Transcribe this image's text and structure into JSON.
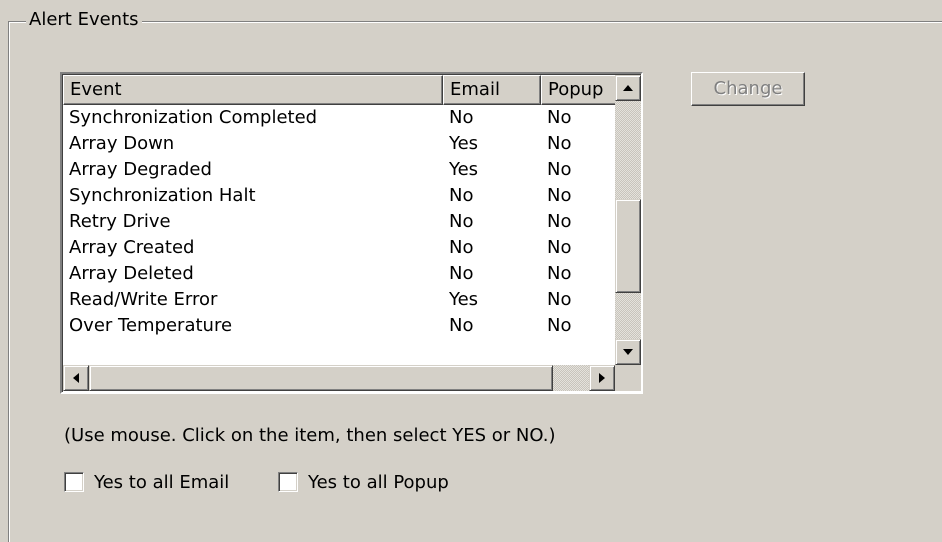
{
  "group": {
    "title": "Alert Events"
  },
  "table": {
    "columns": [
      "Event",
      "Email",
      "Popup"
    ],
    "rows": [
      {
        "event": "Synchronization Completed",
        "email": "No",
        "popup": "No"
      },
      {
        "event": "Array Down",
        "email": "Yes",
        "popup": "No"
      },
      {
        "event": "Array Degraded",
        "email": "Yes",
        "popup": "No"
      },
      {
        "event": "Synchronization Halt",
        "email": "No",
        "popup": "No"
      },
      {
        "event": "Retry Drive",
        "email": "No",
        "popup": "No"
      },
      {
        "event": "Array Created",
        "email": "No",
        "popup": "No"
      },
      {
        "event": "Array Deleted",
        "email": "No",
        "popup": "No"
      },
      {
        "event": "Read/Write Error",
        "email": "Yes",
        "popup": "No"
      },
      {
        "event": "Over Temperature",
        "email": "No",
        "popup": "No"
      }
    ]
  },
  "buttons": {
    "change_label": "Change",
    "change_enabled": false
  },
  "hint": "(Use mouse. Click on the item, then select YES or NO.)",
  "checkboxes": {
    "email_all": {
      "label": "Yes to all Email",
      "checked": false
    },
    "popup_all": {
      "label": "Yes to all Popup",
      "checked": false
    }
  },
  "icons": {
    "scroll_up": "triangle-up",
    "scroll_down": "triangle-down",
    "scroll_left": "triangle-left",
    "scroll_right": "triangle-right"
  }
}
